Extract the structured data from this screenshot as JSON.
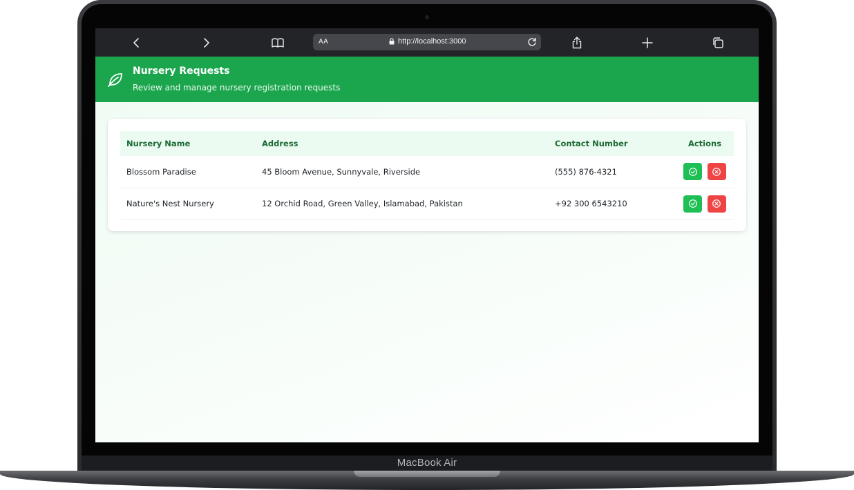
{
  "device": {
    "label": "MacBook Air"
  },
  "browser": {
    "aa_label": "AA",
    "url": "http://localhost:3000"
  },
  "header": {
    "title": "Nursery Requests",
    "subtitle": "Review and manage nursery registration requests"
  },
  "table": {
    "columns": [
      "Nursery Name",
      "Address",
      "Contact Number",
      "Actions"
    ],
    "rows": [
      {
        "name": "Blossom Paradise",
        "address": "45 Bloom Avenue, Sunnyvale, Riverside",
        "contact": "(555) 876-4321"
      },
      {
        "name": "Nature's Nest Nursery",
        "address": "12 Orchid Road, Green Valley, Islamabad, Pakistan",
        "contact": "+92 300 6543210"
      }
    ]
  },
  "colors": {
    "brand_green": "#1ba64d",
    "header_text_green": "#1c6a35",
    "approve": "#20bf55",
    "reject": "#ef4444"
  },
  "icons": {
    "header": "leaf-icon",
    "approve": "check-circle-icon",
    "reject": "x-circle-icon"
  }
}
